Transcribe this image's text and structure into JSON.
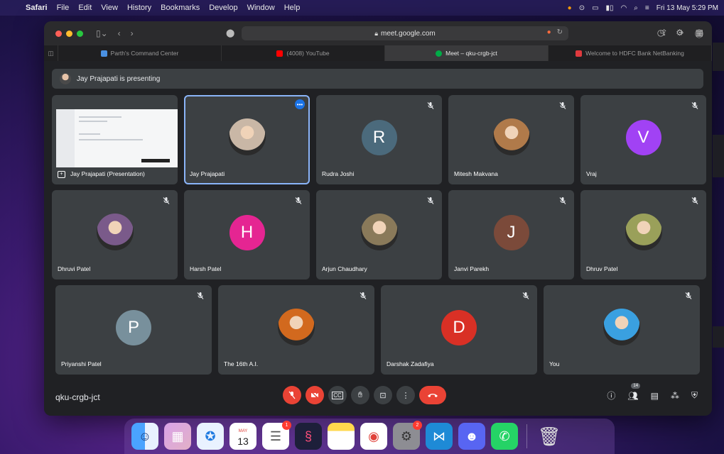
{
  "menubar": {
    "app": "Safari",
    "items": [
      "File",
      "Edit",
      "View",
      "History",
      "Bookmarks",
      "Develop",
      "Window",
      "Help"
    ],
    "datetime": "Fri 13 May  5:29 PM"
  },
  "browser": {
    "url": "meet.google.com",
    "tabs": [
      {
        "label": "Parth's Command Center",
        "color": "#4a90e2"
      },
      {
        "label": "(4008) YouTube",
        "color": "#ff0000"
      },
      {
        "label": "Meet – qku-crgb-jct",
        "color": "#00ac47"
      },
      {
        "label": "Welcome to HDFC Bank NetBanking",
        "color": "#e03a3e"
      }
    ]
  },
  "meet": {
    "presenting_banner": "Jay Prajapati is presenting",
    "meeting_code": "qku-crgb-jct",
    "people_count": "14",
    "participants": [
      {
        "name": "Jay Prajapati (Presentation)",
        "type": "presentation"
      },
      {
        "name": "Jay Prajapati",
        "type": "photo",
        "speaking": true,
        "photo_color": "#c9b7a6"
      },
      {
        "name": "Rudra Joshi",
        "type": "letter",
        "letter": "R",
        "color": "#4b6a7c"
      },
      {
        "name": "Mitesh Makvana",
        "type": "photo",
        "photo_color": "#b07a4a"
      },
      {
        "name": "Vraj",
        "type": "letter",
        "letter": "V",
        "color": "#a142f4"
      },
      {
        "name": "Dhruvi Patel",
        "type": "photo",
        "photo_color": "#7a5a8a"
      },
      {
        "name": "Harsh Patel",
        "type": "letter",
        "letter": "H",
        "color": "#e52592"
      },
      {
        "name": "Arjun Chaudhary",
        "type": "photo",
        "photo_color": "#8a7a5a"
      },
      {
        "name": "Janvi Parekh",
        "type": "letter",
        "letter": "J",
        "color": "#7b4a3a"
      },
      {
        "name": "Dhruv Patel",
        "type": "photo",
        "photo_color": "#9aa05a"
      },
      {
        "name": "Priyanshi Patel",
        "type": "letter",
        "letter": "P",
        "color": "#78909c"
      },
      {
        "name": "The 16th A.I.",
        "type": "photo",
        "photo_color": "#d2691e"
      },
      {
        "name": "Darshak Zadafiya",
        "type": "letter",
        "letter": "D",
        "color": "#d93025"
      },
      {
        "name": "You",
        "type": "photo",
        "photo_color": "#3aa0e0"
      }
    ]
  },
  "dock": {
    "calendar_month": "MAY",
    "calendar_day": "13",
    "reminders_badge": "1",
    "settings_badge": "2"
  }
}
